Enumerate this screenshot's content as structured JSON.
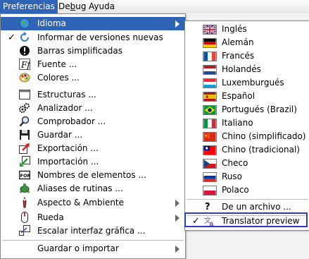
{
  "menubar": {
    "items": [
      {
        "label": "Preferencias",
        "active": true
      },
      {
        "label": "Debug"
      },
      {
        "label": "Ayuda"
      }
    ]
  },
  "preferences_menu": {
    "items": [
      {
        "label": "Idioma",
        "icon": "globe-icon",
        "submenu": true,
        "highlighted": true
      },
      {
        "label": "Informar de versiones nuevas",
        "icon": "refresh-icon",
        "checked": true
      },
      {
        "label": "Barras simplificadas",
        "icon": "exclamation-icon"
      },
      {
        "label": "Fuente ...",
        "icon": "font-icon"
      },
      {
        "label": "Colores ...",
        "icon": "palette-icon"
      },
      {
        "label": "Estructuras ...",
        "icon": "window-icon"
      },
      {
        "label": "Analizador ...",
        "icon": "gears-icon"
      },
      {
        "label": "Comprobador ...",
        "icon": "magnifier-icon"
      },
      {
        "label": "Guardar ...",
        "icon": "floppy-icon"
      },
      {
        "label": "Exportación ...",
        "icon": "export-icon"
      },
      {
        "label": "Importación ...",
        "icon": "import-icon"
      },
      {
        "label": "Nombres de elementos ...",
        "icon": "for-icon"
      },
      {
        "label": "Aliases de rutinas ...",
        "icon": "turtle-icon"
      },
      {
        "label": "Aspecto & Ambiente",
        "icon": "look-feel-icon",
        "submenu": true
      },
      {
        "label": "Rueda",
        "icon": "mouse-icon",
        "submenu": true
      },
      {
        "label": "Escalar interfaz gráfica ...",
        "icon": "scale-icon"
      },
      {
        "label": "Guardar o importar",
        "submenu": true
      }
    ]
  },
  "language_menu": {
    "items": [
      {
        "label": "Inglés",
        "flag": "uk-flag-icon"
      },
      {
        "label": "Alemán",
        "flag": "germany-flag-icon"
      },
      {
        "label": "Francés",
        "flag": "france-flag-icon"
      },
      {
        "label": "Holandés",
        "flag": "netherlands-flag-icon"
      },
      {
        "label": "Luxemburgués",
        "flag": "luxembourg-flag-icon"
      },
      {
        "label": "Español",
        "flag": "spain-flag-icon"
      },
      {
        "label": "Portugués (Brazil)",
        "flag": "brazil-flag-icon"
      },
      {
        "label": "Italiano",
        "flag": "italy-flag-icon"
      },
      {
        "label": "Chino (simplificado)",
        "flag": "china-flag-icon"
      },
      {
        "label": "Chino (tradicional)",
        "flag": "taiwan-flag-icon"
      },
      {
        "label": "Checo",
        "flag": "czech-flag-icon"
      },
      {
        "label": "Ruso",
        "flag": "russia-flag-icon"
      },
      {
        "label": "Polaco",
        "flag": "poland-flag-icon"
      }
    ],
    "from_file": {
      "label": "De un archivo ..."
    },
    "translator": {
      "label": "Translator preview",
      "checked": true
    }
  },
  "colors": {
    "highlight": "#2f64b7",
    "focus_border": "#2b3bd0"
  }
}
